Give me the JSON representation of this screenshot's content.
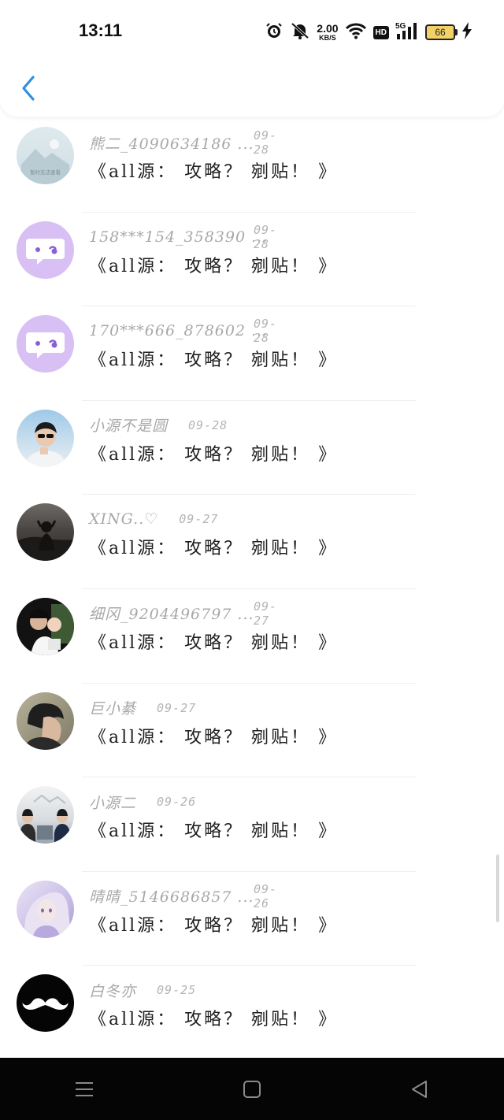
{
  "status_bar": {
    "time": "13:11",
    "net_speed_value": "2.00",
    "net_speed_unit": "KB/S",
    "hd": "HD",
    "signal": "5G",
    "battery": "66"
  },
  "comments": [
    {
      "name": "熊二_4090634186 ...",
      "date": "09-28",
      "content": "《all源： 攻略？ 剜贴！ 》",
      "avatar": "placeholder-image",
      "avatar_text": "暂时无法查看"
    },
    {
      "name": "158***154_358390 ...",
      "date": "09-28",
      "content": "《all源： 攻略？ 剜贴！ 》",
      "avatar": "chat-bubble"
    },
    {
      "name": "170***666_878602 ...",
      "date": "09-28",
      "content": "《all源： 攻略？ 剜贴！ 》",
      "avatar": "chat-bubble"
    },
    {
      "name": "小源不是圆",
      "date": "09-28",
      "content": "《all源： 攻略？ 剜贴！ 》",
      "avatar": "photo-boy"
    },
    {
      "name": "XING..♡",
      "date": "09-27",
      "content": "《all源： 攻略？ 剜贴！ 》",
      "avatar": "photo-dark"
    },
    {
      "name": "细冈_9204496797 ...",
      "date": "09-27",
      "content": "《all源： 攻略？ 剜贴！ 》",
      "avatar": "photo-family"
    },
    {
      "name": "巨小綦",
      "date": "09-27",
      "content": "《all源： 攻略？ 剜贴！ 》",
      "avatar": "photo-portrait"
    },
    {
      "name": "小源二",
      "date": "09-26",
      "content": "《all源： 攻略？ 剜贴！ 》",
      "avatar": "photo-group"
    },
    {
      "name": "晴晴_5146686857 ...",
      "date": "09-26",
      "content": "《all源： 攻略？ 剜贴！ 》",
      "avatar": "photo-anime"
    },
    {
      "name": "白冬亦",
      "date": "09-25",
      "content": "《all源： 攻略？ 剜贴！ 》",
      "avatar": "mustache"
    }
  ],
  "colors": {
    "accent": "#2f8fe0",
    "chat_bubble_bg": "#d9bff5",
    "chat_bubble_fg": "#8a5fd6"
  }
}
